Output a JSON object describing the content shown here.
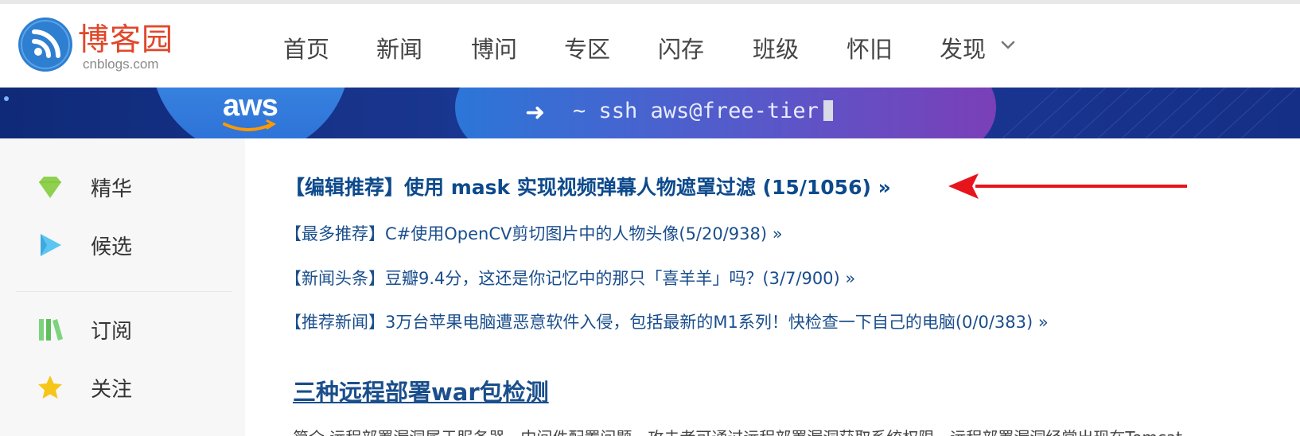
{
  "site": {
    "logo_cn": "博客园",
    "logo_en": "cnblogs.com",
    "brand_color": "#e1472a",
    "logo_color": "#2f7fd1"
  },
  "nav": {
    "items": [
      {
        "label": "首页"
      },
      {
        "label": "新闻"
      },
      {
        "label": "博问"
      },
      {
        "label": "专区"
      },
      {
        "label": "闪存"
      },
      {
        "label": "班级"
      },
      {
        "label": "怀旧"
      },
      {
        "label": "发现"
      }
    ],
    "more_icon": "chevron-down-icon"
  },
  "banner": {
    "brand": "aws",
    "command": "~ ssh aws@free-tier"
  },
  "sidebar": {
    "items": [
      {
        "label": "精华",
        "icon": "gem-icon",
        "color": "#8fd14f"
      },
      {
        "label": "候选",
        "icon": "play-icon",
        "color": "#5bc6f2"
      },
      {
        "label": "订阅",
        "icon": "books-icon",
        "color": "#7ed37e"
      },
      {
        "label": "关注",
        "icon": "star-icon",
        "color": "#f5c518"
      }
    ]
  },
  "recommendations": [
    {
      "text": "【编辑推荐】使用 mask 实现视频弹幕人物遮罩过滤 (15/1056) »"
    },
    {
      "text": "【最多推荐】C#使用OpenCV剪切图片中的人物头像(5/20/938) »"
    },
    {
      "text": "【新闻头条】豆瓣9.4分，这还是你记忆中的那只「喜羊羊」吗？(3/7/900) »"
    },
    {
      "text": "【推荐新闻】3万台苹果电脑遭恶意软件入侵，包括最新的M1系列！快检查一下自己的电脑(0/0/383) »"
    }
  ],
  "post": {
    "title": "三种远程部署war包检测",
    "summary": "简介 远程部署漏洞属于服务器、中间件配置问题，攻击者可通过远程部署漏洞获取系统权限，远程部署漏洞经常出现在Tomcat"
  },
  "annotation": {
    "arrow_color": "#e8141c"
  }
}
